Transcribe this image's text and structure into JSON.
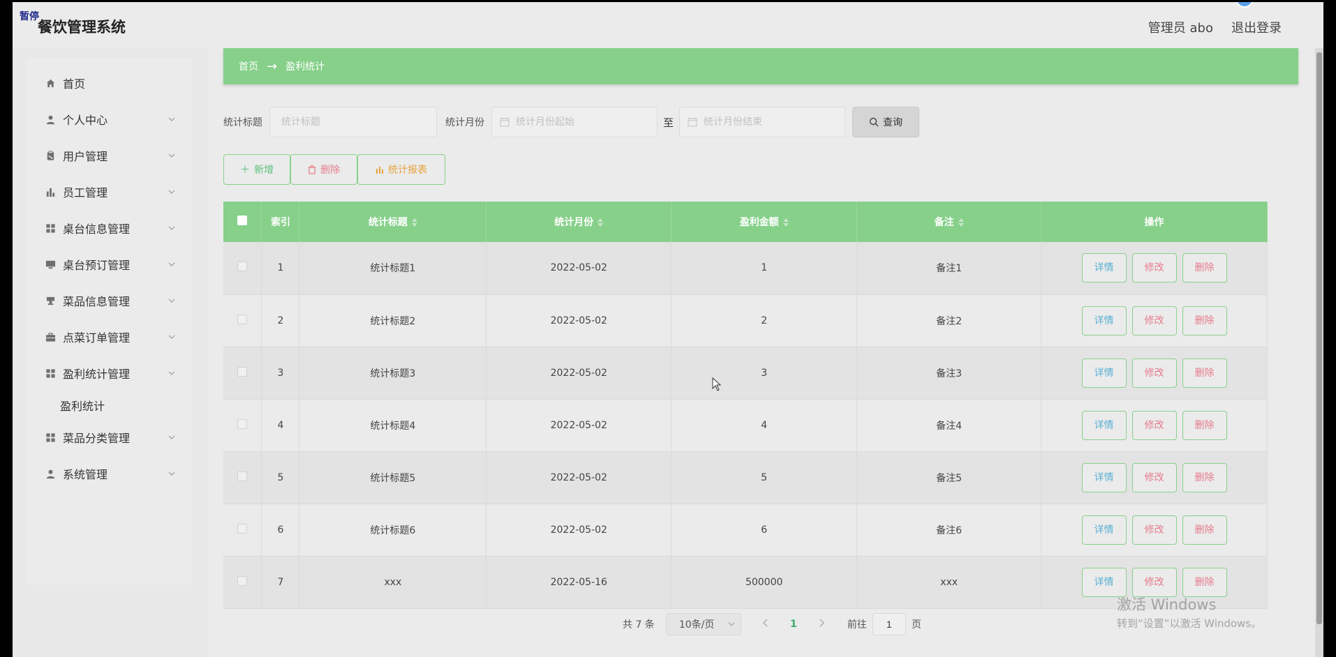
{
  "overlay": {
    "pause_label": "暂停"
  },
  "header": {
    "title": "餐饮管理系统",
    "user_label": "管理员 abo",
    "logout_label": "退出登录"
  },
  "sidebar": {
    "items": [
      {
        "label": "首页",
        "icon": "home-icon"
      },
      {
        "label": "个人中心",
        "icon": "user-icon"
      },
      {
        "label": "用户管理",
        "icon": "clipboard-icon"
      },
      {
        "label": "员工管理",
        "icon": "bar-chart-icon"
      },
      {
        "label": "桌台信息管理",
        "icon": "grid-icon"
      },
      {
        "label": "桌台预订管理",
        "icon": "monitor-icon"
      },
      {
        "label": "菜品信息管理",
        "icon": "stamp-icon"
      },
      {
        "label": "点菜订单管理",
        "icon": "briefcase-icon"
      },
      {
        "label": "盈利统计管理",
        "icon": "grid-icon"
      },
      {
        "label": "菜品分类管理",
        "icon": "grid-icon"
      },
      {
        "label": "系统管理",
        "icon": "user-icon"
      }
    ],
    "sub_item": "盈利统计"
  },
  "breadcrumb": {
    "home": "首页",
    "arrow": "→",
    "current": "盈利统计"
  },
  "search": {
    "title_label": "统计标题",
    "title_placeholder": "统计标题",
    "month_label": "统计月份",
    "month_start_placeholder": "统计月份起始",
    "to_label": "至",
    "month_end_placeholder": "统计月份结束",
    "query_label": "查询"
  },
  "actions": {
    "add": "新增",
    "delete": "删除",
    "report": "统计报表"
  },
  "table": {
    "headers": [
      "索引",
      "统计标题",
      "统计月份",
      "盈利金额",
      "备注",
      "操作"
    ],
    "rows": [
      {
        "index": "1",
        "title": "统计标题1",
        "month": "2022-05-02",
        "amount": "1",
        "note": "备注1"
      },
      {
        "index": "2",
        "title": "统计标题2",
        "month": "2022-05-02",
        "amount": "2",
        "note": "备注2"
      },
      {
        "index": "3",
        "title": "统计标题3",
        "month": "2022-05-02",
        "amount": "3",
        "note": "备注3"
      },
      {
        "index": "4",
        "title": "统计标题4",
        "month": "2022-05-02",
        "amount": "4",
        "note": "备注4"
      },
      {
        "index": "5",
        "title": "统计标题5",
        "month": "2022-05-02",
        "amount": "5",
        "note": "备注5"
      },
      {
        "index": "6",
        "title": "统计标题6",
        "month": "2022-05-02",
        "amount": "6",
        "note": "备注6"
      },
      {
        "index": "7",
        "title": "xxx",
        "month": "2022-05-16",
        "amount": "500000",
        "note": "xxx"
      }
    ],
    "row_actions": {
      "detail": "详情",
      "edit": "修改",
      "delete": "删除"
    }
  },
  "pagination": {
    "total": "共 7 条",
    "page_size": "10条/页",
    "current_page": "1",
    "goto_label": "前往",
    "goto_value": "1",
    "page_suffix": "页"
  },
  "watermark": {
    "line1": "激活 Windows",
    "line2": "转到“设置”以激活 Windows。"
  },
  "colors": {
    "accent": "#86d08a",
    "detail": "#5ab0d4",
    "danger": "#e67c8c",
    "warning": "#e6a23c"
  }
}
